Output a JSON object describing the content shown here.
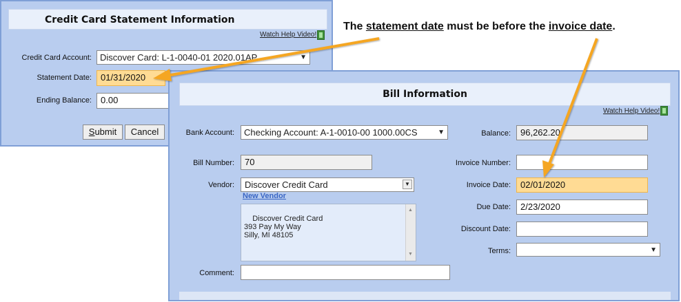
{
  "annotation": {
    "prefix": "The ",
    "term1": "statement date",
    "middle": " must be before the ",
    "term2": "invoice date",
    "suffix": "."
  },
  "cc_panel": {
    "title": "Credit Card Statement Information",
    "help_link": "Watch Help Video!",
    "credit_card_account_label": "Credit Card Account:",
    "credit_card_account_value": "Discover Card: L-1-0040-01 2020.01AP",
    "statement_date_label": "Statement Date:",
    "statement_date_value": "01/31/2020",
    "ending_balance_label": "Ending Balance:",
    "ending_balance_value": "0.00",
    "submit_label": "Submit",
    "submit_accesskey": "S",
    "submit_rest": "ubmit",
    "cancel_label": "Cancel"
  },
  "bill_panel": {
    "title": "Bill Information",
    "help_link": "Watch Help Video!",
    "bank_account_label": "Bank Account:",
    "bank_account_value": "Checking Account: A-1-0010-00 1000.00CS",
    "bill_number_label": "Bill Number:",
    "bill_number_value": "70",
    "vendor_label": "Vendor:",
    "vendor_value": "Discover Credit Card",
    "new_vendor_link": "New Vendor",
    "vendor_address": "Discover Credit Card\n393 Pay My Way\nSilly, MI 48105",
    "comment_label": "Comment:",
    "comment_value": "",
    "balance_label": "Balance:",
    "balance_value": "96,262.20",
    "invoice_number_label": "Invoice Number:",
    "invoice_number_value": "",
    "invoice_date_label": "Invoice Date:",
    "invoice_date_value": "02/01/2020",
    "due_date_label": "Due Date:",
    "due_date_value": "2/23/2020",
    "discount_date_label": "Discount Date:",
    "discount_date_value": "",
    "terms_label": "Terms:",
    "terms_value": ""
  },
  "colors": {
    "panel_bg": "#b9cdef",
    "panel_border": "#7f9fd6",
    "highlight": "#ffdb94",
    "arrow": "#f5a623"
  },
  "icons": [
    "film-icon",
    "dropdown-caret-icon",
    "arrow-annotation"
  ]
}
